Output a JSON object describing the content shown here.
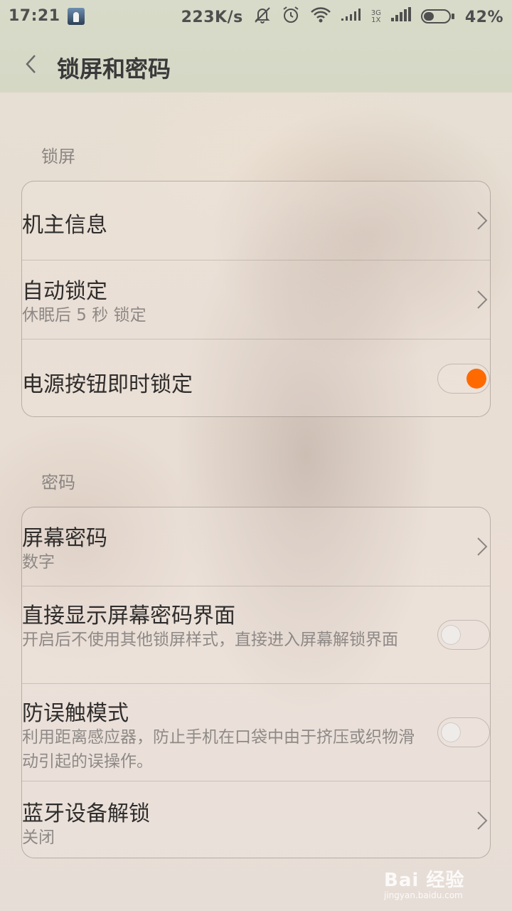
{
  "status_bar": {
    "time": "17:21",
    "speed": "223K/s",
    "net_type_top": "3G",
    "net_type_bottom": "1X",
    "battery": "42%",
    "battery_level": 0.42
  },
  "header": {
    "title": "锁屏和密码"
  },
  "lockscreen_section": {
    "label": "锁屏",
    "items": [
      {
        "title": "机主信息"
      },
      {
        "title": "自动锁定",
        "subtitle": "休眠后 5 秒 锁定"
      },
      {
        "title": "电源按钮即时锁定",
        "toggle": "on"
      }
    ]
  },
  "password_section": {
    "label": "密码",
    "items": [
      {
        "title": "屏幕密码",
        "subtitle": "数字"
      },
      {
        "title": "直接显示屏幕密码界面",
        "subtitle": "开启后不使用其他锁屏样式，直接进入屏幕解锁界面",
        "toggle": "off"
      },
      {
        "title": "防误触模式",
        "subtitle": "利用距离感应器，防止手机在口袋中由于挤压或织物滑动引起的误操作。",
        "toggle": "off"
      },
      {
        "title": "蓝牙设备解锁",
        "subtitle": "关闭"
      }
    ]
  },
  "watermark": {
    "main": "Bai 经验",
    "sub": "jingyan.baidu.com"
  },
  "colors": {
    "accent": "#ff6a00",
    "title_text": "#2f2d2c",
    "subtitle_text": "#8e8986"
  }
}
